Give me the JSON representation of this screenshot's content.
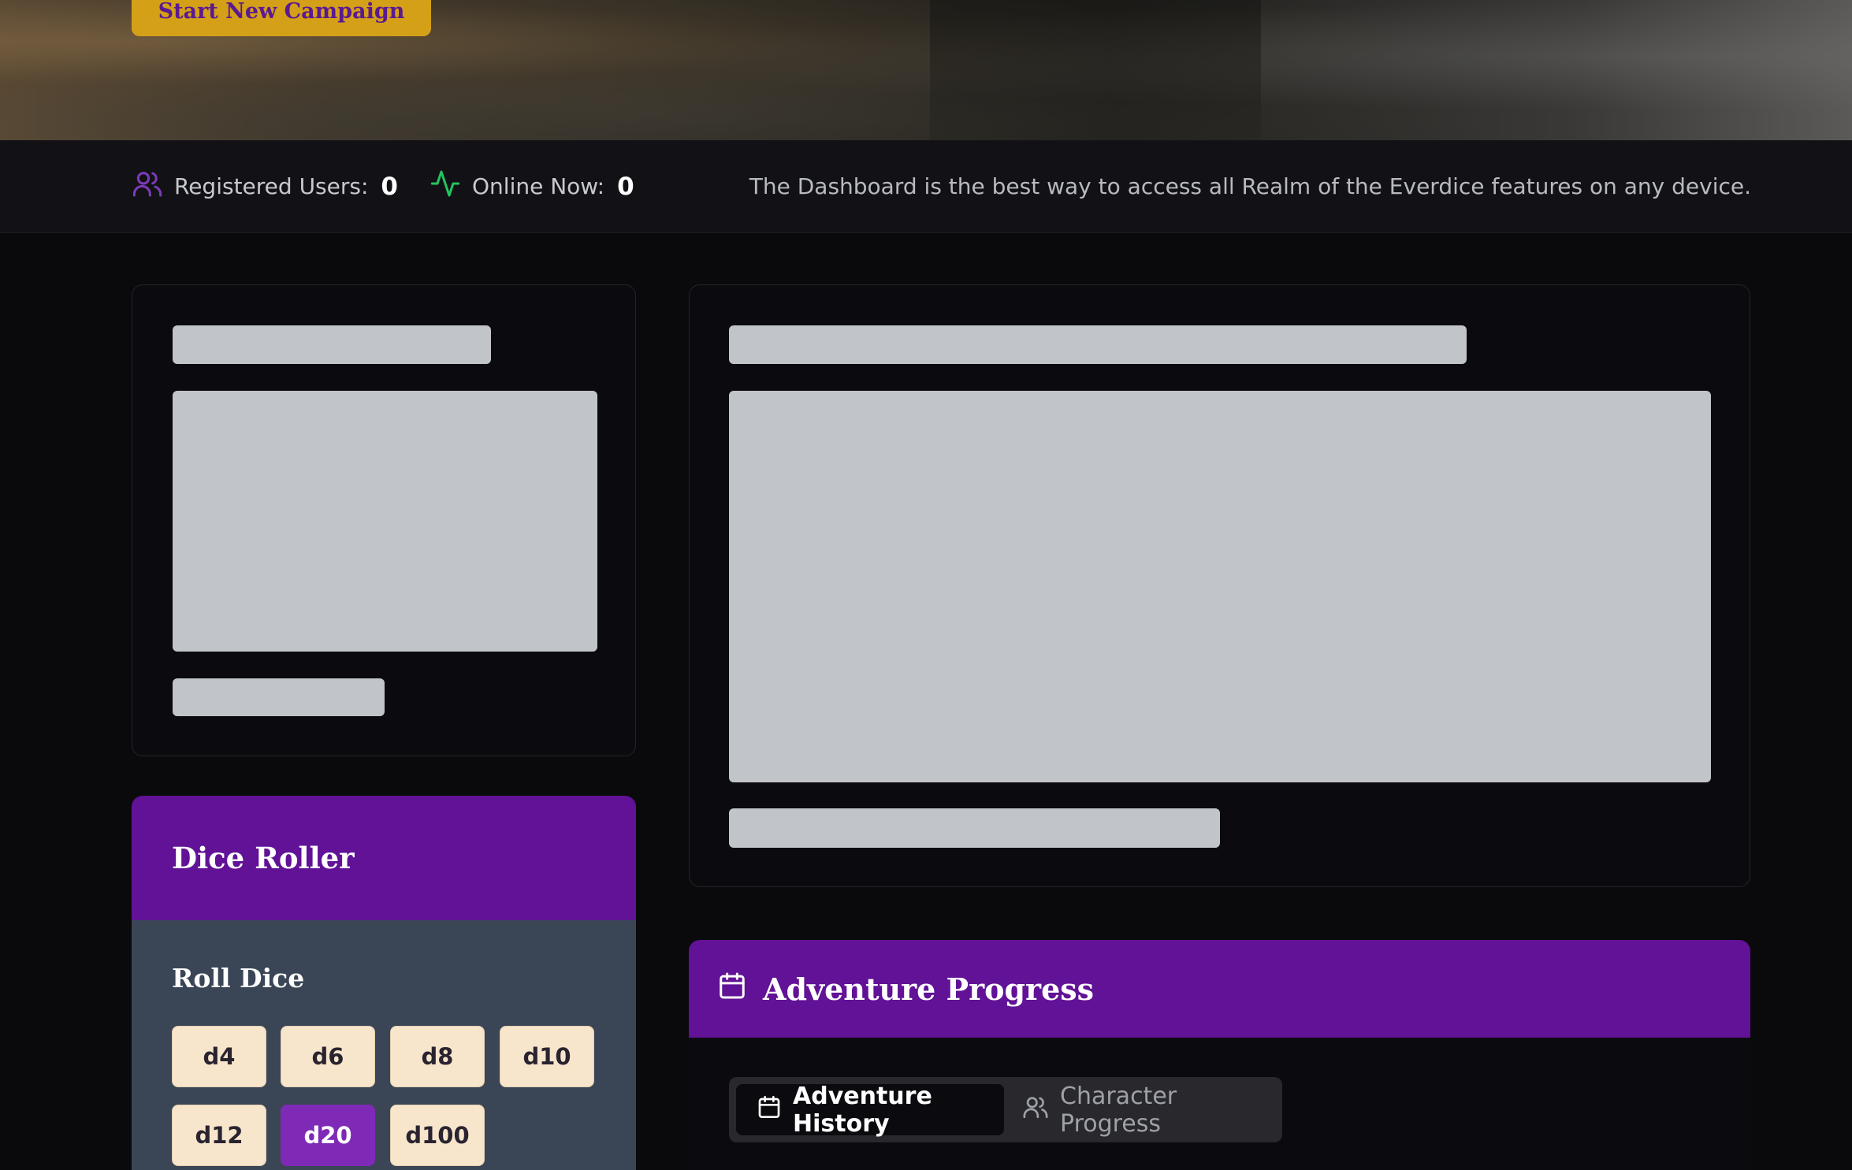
{
  "hero": {
    "cta_label": "Start New Campaign"
  },
  "stats": {
    "registered_label": "Registered Users:",
    "registered_value": "0",
    "online_label": "Online Now:",
    "online_value": "0",
    "note": "The Dashboard is the best way to access all Realm of the Everdice features on any device."
  },
  "dice_roller": {
    "title": "Dice Roller",
    "subtitle": "Roll Dice",
    "dice": [
      "d4",
      "d6",
      "d8",
      "d10",
      "d12",
      "d20",
      "d100"
    ],
    "selected": "d20"
  },
  "adventure_progress": {
    "title": "Adventure Progress",
    "tabs": [
      {
        "label": "Adventure History",
        "active": true
      },
      {
        "label": "Character Progress",
        "active": false
      }
    ]
  },
  "colors": {
    "accent_purple": "#611296",
    "gold": "#d4a017",
    "active_die": "#7f2ab6",
    "online_green": "#22c55e"
  },
  "icons": {
    "registered": "users-icon",
    "online": "activity-icon",
    "adventure": "calendar-icon",
    "character": "users-icon"
  }
}
